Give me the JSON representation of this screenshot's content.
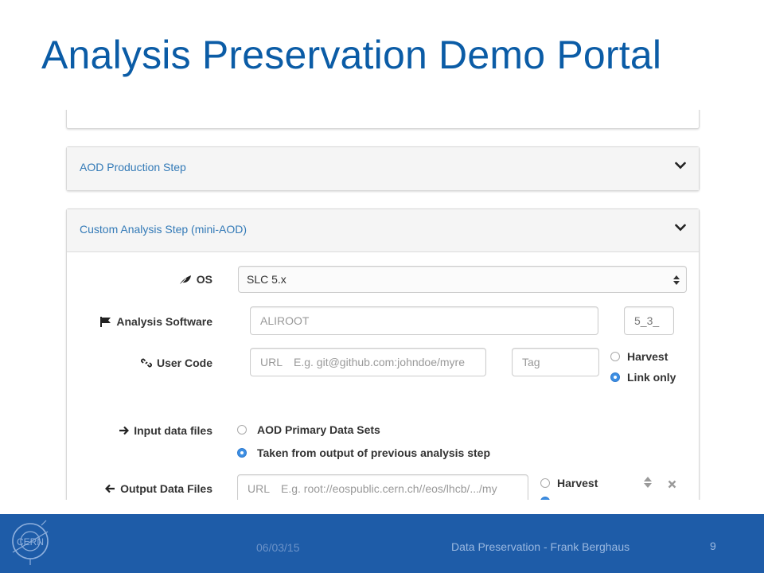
{
  "slide": {
    "title": "Analysis Preservation Demo Portal",
    "footer_date": "06/03/15",
    "footer_center": "Data Preservation - Frank Berghaus",
    "page_number": "9",
    "logo_text": "CERN"
  },
  "panels": {
    "aod_title": "AOD Production Step",
    "custom_title": "Custom Analysis Step (mini-AOD)"
  },
  "form": {
    "os_label": "OS",
    "os_value": "SLC 5.x",
    "software_label": "Analysis Software",
    "software_placeholder": "ALIROOT",
    "software_version": "5_3_",
    "usercode_label": "User Code",
    "usercode_prefix": "URL",
    "usercode_placeholder": "E.g. git@github.com:johndoe/myre",
    "tag_placeholder": "Tag",
    "harvest_label": "Harvest",
    "link_only_label": "Link only",
    "input_label": "Input data files",
    "input_option_1": "AOD Primary Data Sets",
    "input_option_2": "Taken from output of previous analysis step",
    "output_label": "Output Data Files",
    "output_prefix": "URL",
    "output_placeholder": "E.g. root://eospublic.cern.ch//eos/lhcb/.../my",
    "output_harvest_label": "Harvest"
  },
  "colors": {
    "title_blue": "#0b5ca6",
    "link_blue": "#337ab7",
    "footer_blue": "#1e5ca8",
    "radio_selected": "#3d8fe3"
  },
  "icons": [
    "leaf-icon",
    "flag-icon",
    "link-icon",
    "arrow-right-icon",
    "arrow-left-icon",
    "chevron-down-icon",
    "sort-icon",
    "close-icon",
    "select-caret-icon"
  ]
}
